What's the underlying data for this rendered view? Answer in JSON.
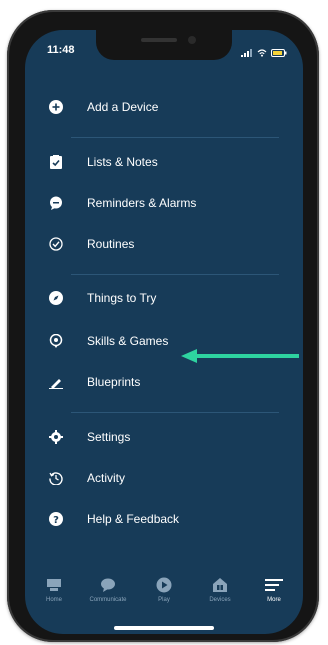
{
  "status_bar": {
    "time": "11:48"
  },
  "menu": {
    "items": [
      {
        "label": "Add a Device",
        "icon": "plus-circle-icon"
      },
      {
        "label": "Lists & Notes",
        "icon": "list-check-icon"
      },
      {
        "label": "Reminders & Alarms",
        "icon": "chat-bubble-icon"
      },
      {
        "label": "Routines",
        "icon": "check-circle-icon"
      },
      {
        "label": "Things to Try",
        "icon": "compass-icon"
      },
      {
        "label": "Skills & Games",
        "icon": "skills-icon"
      },
      {
        "label": "Blueprints",
        "icon": "pencil-icon"
      },
      {
        "label": "Settings",
        "icon": "gear-icon"
      },
      {
        "label": "Activity",
        "icon": "history-icon"
      },
      {
        "label": "Help & Feedback",
        "icon": "question-circle-icon"
      }
    ]
  },
  "tabbar": {
    "tabs": [
      {
        "label": "Home",
        "icon": "home-icon",
        "active": false
      },
      {
        "label": "Communicate",
        "icon": "communicate-icon",
        "active": false
      },
      {
        "label": "Play",
        "icon": "play-icon",
        "active": false
      },
      {
        "label": "Devices",
        "icon": "devices-icon",
        "active": false
      },
      {
        "label": "More",
        "icon": "menu-icon",
        "active": true
      }
    ]
  },
  "colors": {
    "background": "#173b58",
    "accent_arrow": "#2ed3a0",
    "text": "#ffffff"
  }
}
